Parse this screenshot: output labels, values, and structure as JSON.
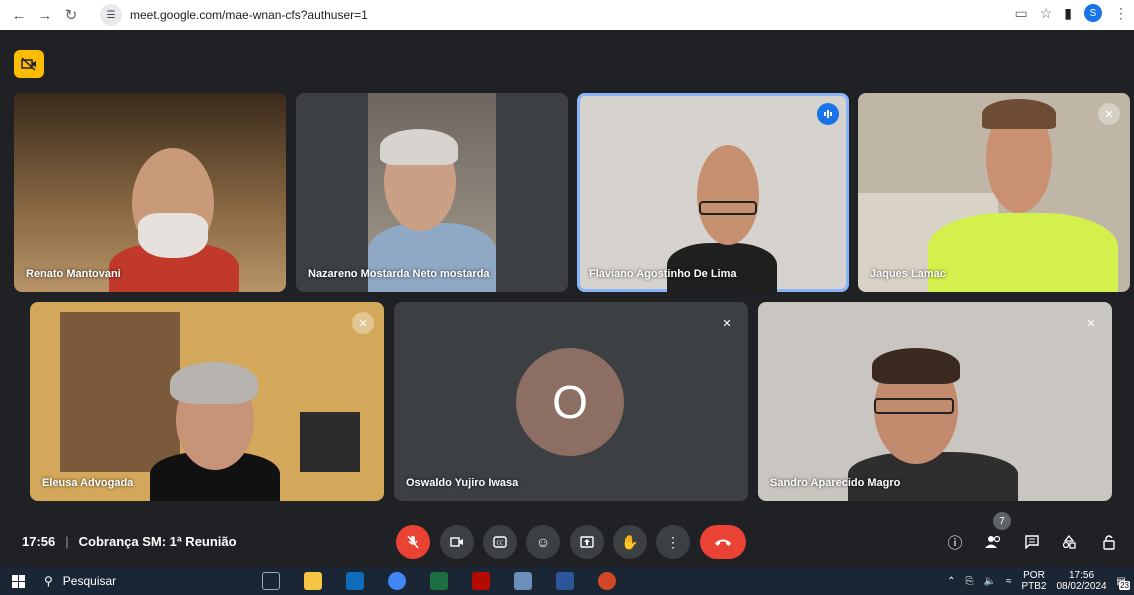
{
  "browser": {
    "url": "meet.google.com/mae-wnan-cfs?authuser=1",
    "profile_initial": "S"
  },
  "participants": [
    {
      "name": "Renato Mantovani"
    },
    {
      "name": "Nazareno Mostarda Neto mostarda"
    },
    {
      "name": "Flaviano Agostinho De Lima"
    },
    {
      "name": "Jaques Lamac"
    },
    {
      "name": "Eleusa Advogada"
    },
    {
      "name": "Oswaldo Yujiro Iwasa",
      "avatar_initial": "O"
    },
    {
      "name": "Sandro Aparecido Magro"
    }
  ],
  "meeting": {
    "time": "17:56",
    "separator": "|",
    "title": "Cobrança SM: 1ª Reunião",
    "people_count": "7"
  },
  "taskbar": {
    "search_placeholder": "Pesquisar",
    "language": "POR",
    "layout": "PTB2",
    "time": "17:56",
    "date": "08/02/2024",
    "notifications": "23"
  },
  "colors": {
    "meet_bg": "#202124",
    "tile_bg": "#3c4043",
    "accent_blue": "#1a73e8",
    "red": "#ea4335",
    "yellow_badge": "#fbbc04",
    "avatar_brown": "#8d6e63"
  }
}
